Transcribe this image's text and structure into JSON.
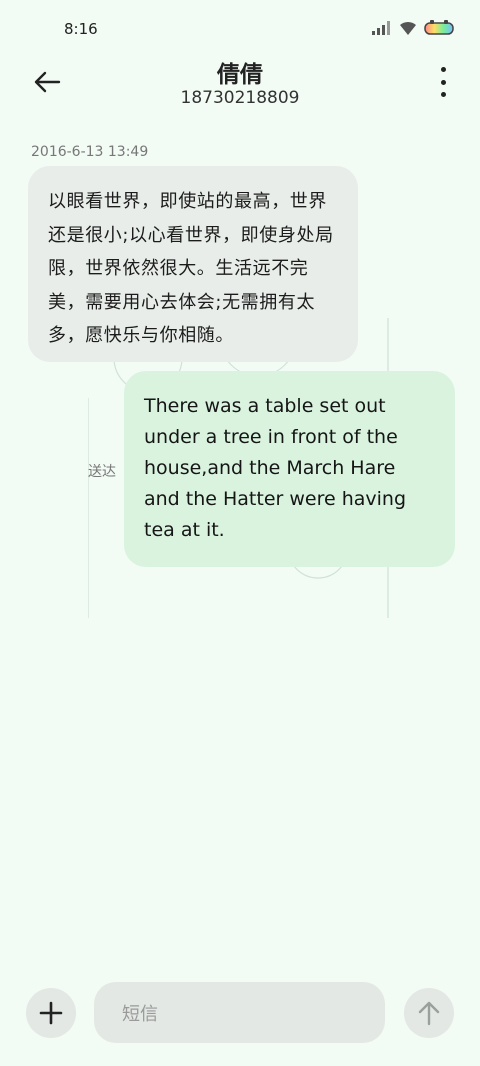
{
  "status_bar": {
    "time": "8:16"
  },
  "header": {
    "contact_name": "倩倩",
    "phone_number": "18730218809"
  },
  "messages": [
    {
      "timestamp": "2016-6-13 13:49",
      "direction": "incoming",
      "text": "以眼看世界，即使站的最高，世界还是很小;以心看世界，即使身处局限，世界依然很大。生活远不完美，需要用心去体会;无需拥有太多，愿快乐与你相随。"
    },
    {
      "direction": "outgoing",
      "status": "送达",
      "text": "There was a table set out under a tree in front of the house,and the March Hare and the Hatter were having tea at it."
    }
  ],
  "composer": {
    "placeholder": "短信"
  },
  "icons": {
    "back": "arrow-left-icon",
    "menu": "more-vertical-icon",
    "add": "plus-icon",
    "send": "arrow-up-icon",
    "signal": "signal-icon",
    "wifi": "wifi-icon",
    "battery": "battery-icon"
  },
  "colors": {
    "background": "#f3fbf5",
    "incoming_bubble": "#e8ede9",
    "outgoing_bubble": "#d9f3df",
    "button": "#e3e8e4"
  }
}
